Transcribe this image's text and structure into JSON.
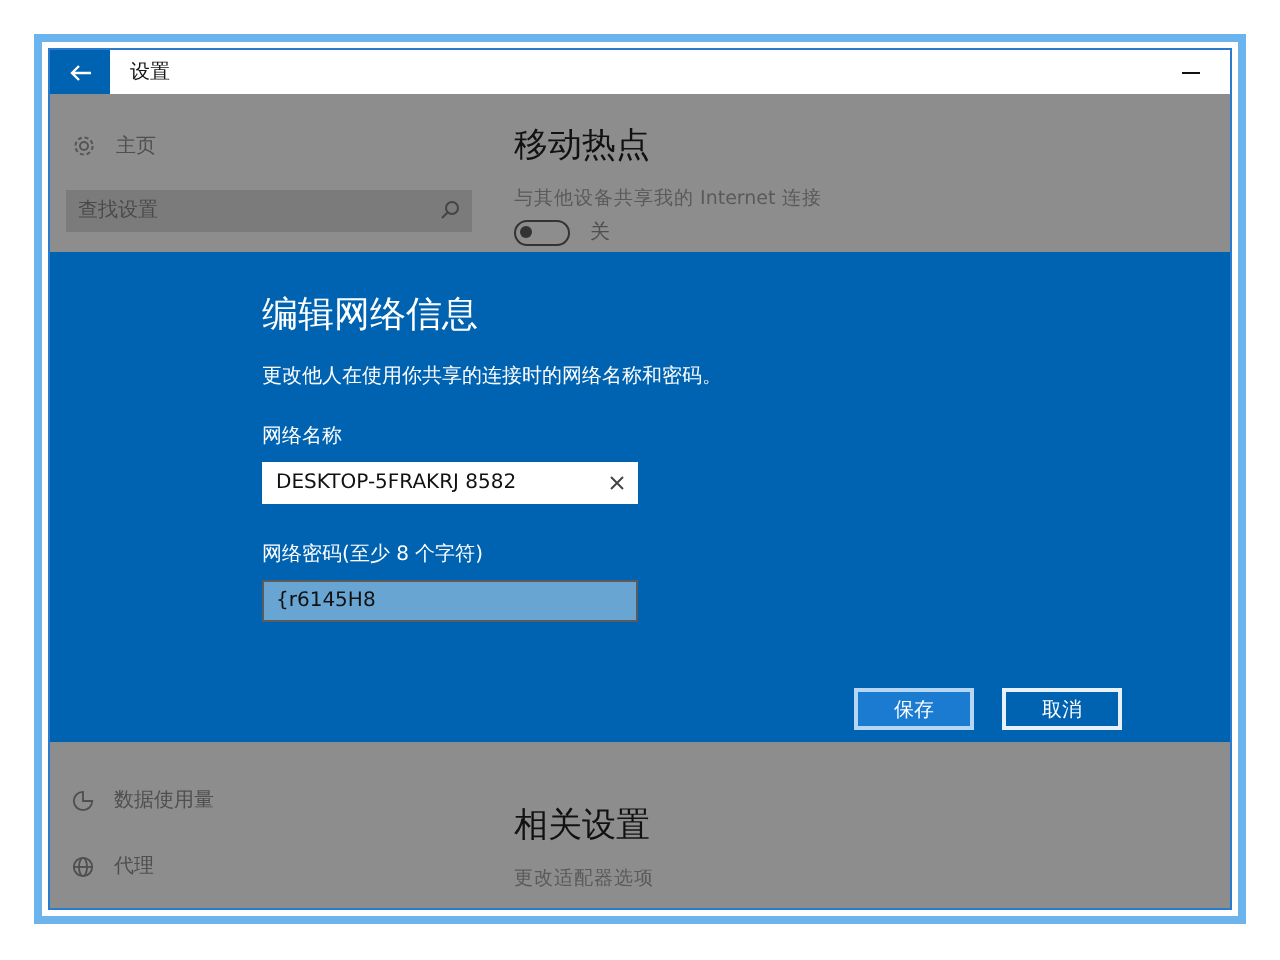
{
  "window": {
    "title": "设置"
  },
  "sidebar": {
    "home": "主页",
    "search": {
      "placeholder": "查找设置"
    },
    "items": [
      {
        "label": "数据使用量",
        "kind": "chart"
      },
      {
        "label": "代理",
        "kind": "globe"
      }
    ]
  },
  "content": {
    "heading": "移动热点",
    "share_label": "与其他设备共享我的 Internet 连接",
    "toggle": {
      "on": false,
      "label": "关"
    },
    "related_heading": "相关设置",
    "related_link": "更改适配器选项"
  },
  "dialog": {
    "title": "编辑网络信息",
    "description": "更改他人在使用你共享的连接时的网络名称和密码。",
    "fields": [
      {
        "label": "网络名称",
        "value": "DESKTOP-5FRAKRJ 8582",
        "focused": true
      },
      {
        "label": "网络密码(至少 8 个字符)",
        "value": "{r6145H8",
        "focused": false
      }
    ],
    "buttons": [
      {
        "label": "保存",
        "primary": true
      },
      {
        "label": "取消",
        "primary": false
      }
    ]
  }
}
